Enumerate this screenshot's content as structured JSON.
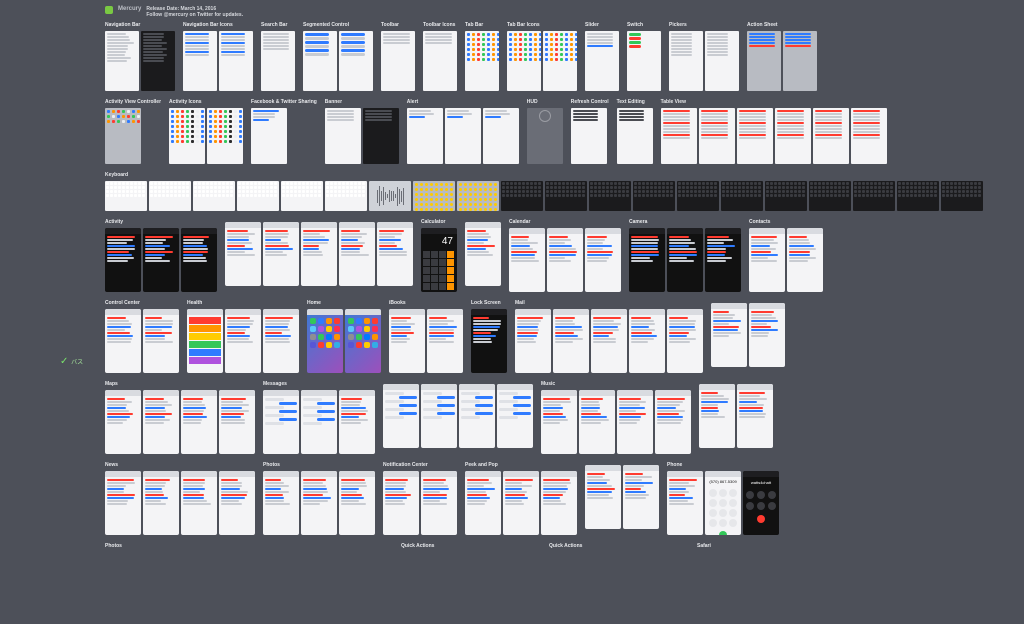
{
  "banner": {
    "brand": "Mercury",
    "title": "Release Date: March 14, 2016",
    "subtitle": "Follow @mercury on Twitter for updates."
  },
  "row1": [
    {
      "label": "Navigation Bar",
      "tiles": [
        [
          "light",
          "list"
        ],
        [
          "dark",
          "list"
        ]
      ]
    },
    {
      "label": "Navigation Bar Icons",
      "tiles": [
        [
          "light",
          "btns"
        ],
        [
          "light",
          "btns"
        ]
      ]
    },
    {
      "label": "Search Bar",
      "tiles": [
        [
          "light",
          "search"
        ]
      ]
    },
    {
      "label": "Segmented Control",
      "tiles": [
        [
          "light",
          "seg"
        ],
        [
          "light",
          "seg"
        ]
      ]
    },
    {
      "label": "Toolbar",
      "tiles": [
        [
          "light",
          "bar"
        ]
      ]
    },
    {
      "label": "Toolbar Icons",
      "tiles": [
        [
          "light",
          "bar"
        ]
      ]
    },
    {
      "label": "Tab Bar",
      "tiles": [
        [
          "light",
          "icons"
        ]
      ]
    },
    {
      "label": "Tab Bar Icons",
      "tiles": [
        [
          "light",
          "icons"
        ],
        [
          "light",
          "icons"
        ]
      ]
    },
    {
      "label": "Slider",
      "tiles": [
        [
          "light",
          "slider"
        ]
      ]
    },
    {
      "label": "Switch",
      "tiles": [
        [
          "light",
          "switch"
        ]
      ]
    },
    {
      "label": "Pickers",
      "tiles": [
        [
          "light",
          "picker"
        ],
        [
          "light",
          "picker"
        ]
      ]
    },
    {
      "label": "Action Sheet",
      "tiles": [
        [
          "gray",
          "sheet"
        ],
        [
          "gray",
          "sheet"
        ]
      ]
    }
  ],
  "row2": [
    {
      "label": "Activity View Controller",
      "tiles": [
        [
          "gray",
          "share"
        ]
      ]
    },
    {
      "label": "Activity Icons",
      "tiles": [
        [
          "light",
          "iconset"
        ],
        [
          "light",
          "iconset"
        ]
      ]
    },
    {
      "label": "Facebook & Twitter Sharing",
      "tiles": [
        [
          "light",
          "share2"
        ]
      ]
    },
    {
      "label": "Banner",
      "tiles": [
        [
          "light",
          "banner"
        ],
        [
          "dark",
          "banner"
        ]
      ]
    },
    {
      "label": "Alert",
      "tiles": [
        [
          "light",
          "alert"
        ],
        [
          "light",
          "alert"
        ],
        [
          "light",
          "alert"
        ]
      ]
    },
    {
      "label": "HUD",
      "tiles": [
        [
          "trans",
          "hud"
        ]
      ]
    },
    {
      "label": "Refresh Control",
      "tiles": [
        [
          "light",
          "ref"
        ]
      ]
    },
    {
      "label": "Text Editing",
      "tiles": [
        [
          "light",
          "text"
        ]
      ]
    },
    {
      "label": "Table View",
      "tiles": [
        [
          "light",
          "table"
        ],
        [
          "light",
          "table"
        ],
        [
          "light",
          "table"
        ],
        [
          "light",
          "table"
        ],
        [
          "light",
          "table"
        ],
        [
          "light",
          "table"
        ]
      ]
    }
  ],
  "row3_label": "Keyboard",
  "row4": [
    {
      "label": "Activity",
      "count": 3,
      "dark": true
    },
    {
      "label": "",
      "count": 5
    },
    {
      "label": "Calculator",
      "count": 1,
      "dark": true
    },
    {
      "label": "",
      "count": 1
    },
    {
      "label": "Calendar",
      "count": 3
    },
    {
      "label": "Camera",
      "count": 3,
      "dark": true
    },
    {
      "label": "Contacts",
      "count": 2
    }
  ],
  "row5": [
    {
      "label": "Control Center",
      "count": 2
    },
    {
      "label": "Health",
      "count": 3
    },
    {
      "label": "Home",
      "count": 2,
      "special": "home"
    },
    {
      "label": "iBooks",
      "count": 2
    },
    {
      "label": "Lock Screen",
      "count": 1,
      "dark": true
    },
    {
      "label": "Mail",
      "count": 5
    },
    {
      "label": "",
      "count": 2
    }
  ],
  "row6": [
    {
      "label": "Maps",
      "count": 4
    },
    {
      "label": "Messages",
      "count": 3
    },
    {
      "label": "",
      "count": 4
    },
    {
      "label": "Music",
      "count": 4
    },
    {
      "label": "",
      "count": 2
    }
  ],
  "row7": [
    {
      "label": "News",
      "count": 4
    },
    {
      "label": "Photos",
      "count": 3
    },
    {
      "label": "Notification Center",
      "count": 2
    },
    {
      "label": "Peek and Pop",
      "count": 3
    },
    {
      "label": "",
      "count": 2
    },
    {
      "label": "Phone",
      "count": 3,
      "special": "phone"
    }
  ],
  "row8_labels": [
    "Photos",
    "",
    "Quick Actions",
    "Quick Actions",
    "Safari",
    ""
  ],
  "calc_display": "47",
  "health_colors": [
    "#ff3b30",
    "#ff9500",
    "#ffcc00",
    "#33c759",
    "#2f7bff",
    "#af52de"
  ],
  "home_colors": [
    "#33c759",
    "#2f7bff",
    "#ff9500",
    "#ff3b30",
    "#5ac8fa",
    "#af52de",
    "#ffcc00",
    "#ff2d55",
    "#8e8e93",
    "#34c759",
    "#007aff",
    "#ff9500",
    "#5856d6",
    "#ff3b30",
    "#ffcc00",
    "#32ade6"
  ],
  "phone": {
    "number": "(570) 867-5309",
    "name": "watts4chatt"
  }
}
